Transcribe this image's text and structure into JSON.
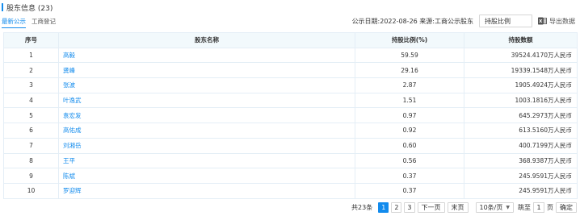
{
  "section": {
    "title": "股东信息",
    "count": "(23)"
  },
  "tabs": [
    {
      "label": "最新公示",
      "active": true
    },
    {
      "label": "工商登记",
      "active": false
    }
  ],
  "filter": {
    "publish_info": "公示日期:2022-08-26 来源:工商公示股东",
    "dropdown_value": "持股比例",
    "export_label": "导出数据"
  },
  "table": {
    "headers": {
      "index": "序号",
      "name": "股东名称",
      "ratio": "持股比例(%)",
      "amount": "持股数额"
    },
    "rows": [
      {
        "index": "1",
        "name": "高毅",
        "ratio": "59.59",
        "amount": "39524.4170万人民币"
      },
      {
        "index": "2",
        "name": "龚峰",
        "ratio": "29.16",
        "amount": "19339.1548万人民币"
      },
      {
        "index": "3",
        "name": "张波",
        "ratio": "2.87",
        "amount": "1905.4924万人民币"
      },
      {
        "index": "4",
        "name": "叶逸武",
        "ratio": "1.51",
        "amount": "1003.1816万人民币"
      },
      {
        "index": "5",
        "name": "袁宏发",
        "ratio": "0.97",
        "amount": "645.2973万人民币"
      },
      {
        "index": "6",
        "name": "高佑成",
        "ratio": "0.92",
        "amount": "613.5160万人民币"
      },
      {
        "index": "7",
        "name": "刘湘岳",
        "ratio": "0.60",
        "amount": "400.7199万人民币"
      },
      {
        "index": "8",
        "name": "王平",
        "ratio": "0.56",
        "amount": "368.9387万人民币"
      },
      {
        "index": "9",
        "name": "陈斌",
        "ratio": "0.37",
        "amount": "245.9591万人民币"
      },
      {
        "index": "10",
        "name": "罗迎辉",
        "ratio": "0.37",
        "amount": "245.9591万人民币"
      }
    ]
  },
  "pagination": {
    "total": "共23条",
    "pages": [
      "1",
      "2",
      "3"
    ],
    "current_page": "1",
    "next": "下一页",
    "last": "末页",
    "page_size": "10条/页",
    "jump_label": "跳至",
    "jump_value": "1",
    "page_unit": "页",
    "confirm": "确定"
  },
  "colors": {
    "accent": "#128bed",
    "header_bg": "#f2f9fc",
    "border": "#e4eef6"
  }
}
